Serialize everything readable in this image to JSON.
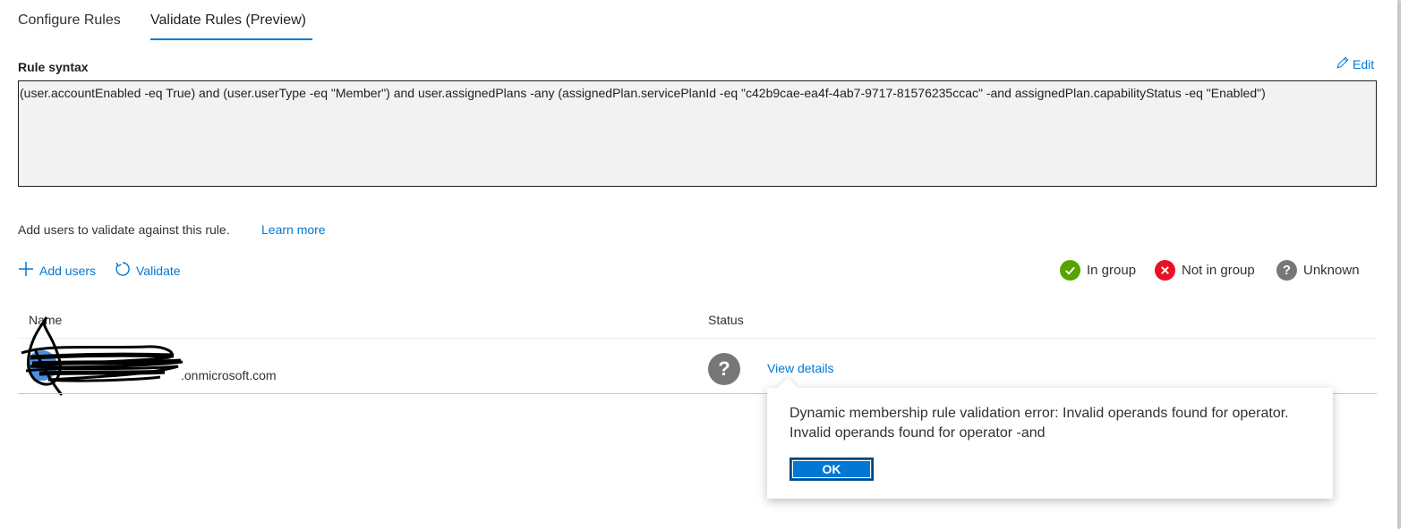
{
  "tabs": [
    {
      "label": "Configure Rules"
    },
    {
      "label": "Validate Rules (Preview)"
    }
  ],
  "rule": {
    "title": "Rule syntax",
    "edit_label": "Edit",
    "syntax": "(user.accountEnabled -eq True) and (user.userType -eq \"Member\") and user.assignedPlans -any (assignedPlan.servicePlanId -eq \"c42b9cae-ea4f-4ab7-9717-81576235ccac\" -and assignedPlan.capabilityStatus -eq \"Enabled\")"
  },
  "validate": {
    "description": "Add users to validate against this rule.",
    "learn_more": "Learn more",
    "add_users_label": "Add users",
    "validate_label": "Validate"
  },
  "legend": [
    {
      "label": "In group",
      "icon": "check-icon",
      "color": "#57a300"
    },
    {
      "label": "Not in group",
      "icon": "x-icon",
      "color": "#e81123"
    },
    {
      "label": "Unknown",
      "icon": "question-icon",
      "color": "#797775"
    }
  ],
  "table": {
    "columns": [
      "Name",
      "Status"
    ],
    "rows": [
      {
        "email_suffix": ".onmicrosoft.com",
        "status_icon": "question-icon",
        "view_details": "View details"
      }
    ]
  },
  "callout": {
    "line1": "Dynamic membership rule validation error: Invalid operands found for operator.",
    "line2": "Invalid operands found for operator -and",
    "ok_label": "OK"
  },
  "colors": {
    "accent": "#0078d4",
    "syntax_bg": "#f2f2f2"
  }
}
